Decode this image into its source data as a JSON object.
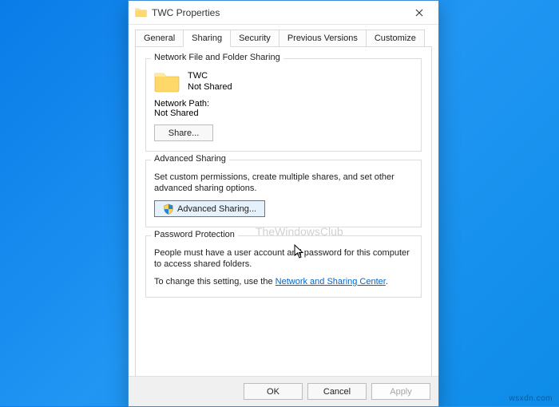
{
  "window": {
    "title": "TWC Properties"
  },
  "tabs": [
    "General",
    "Sharing",
    "Security",
    "Previous Versions",
    "Customize"
  ],
  "active_tab_index": 1,
  "group_network": {
    "legend": "Network File and Folder Sharing",
    "folder_name": "TWC",
    "share_status": "Not Shared",
    "path_label": "Network Path:",
    "path_value": "Not Shared",
    "share_button": "Share..."
  },
  "group_advanced": {
    "legend": "Advanced Sharing",
    "description": "Set custom permissions, create multiple shares, and set other advanced sharing options.",
    "button": "Advanced Sharing..."
  },
  "group_password": {
    "legend": "Password Protection",
    "line1": "People must have a user account and password for this computer to access shared folders.",
    "line2_prefix": "To change this setting, use the ",
    "line2_link": "Network and Sharing Center",
    "line2_suffix": "."
  },
  "footer": {
    "ok": "OK",
    "cancel": "Cancel",
    "apply": "Apply"
  },
  "watermark": "TheWindowsClub",
  "branding": "wsxdn.com"
}
